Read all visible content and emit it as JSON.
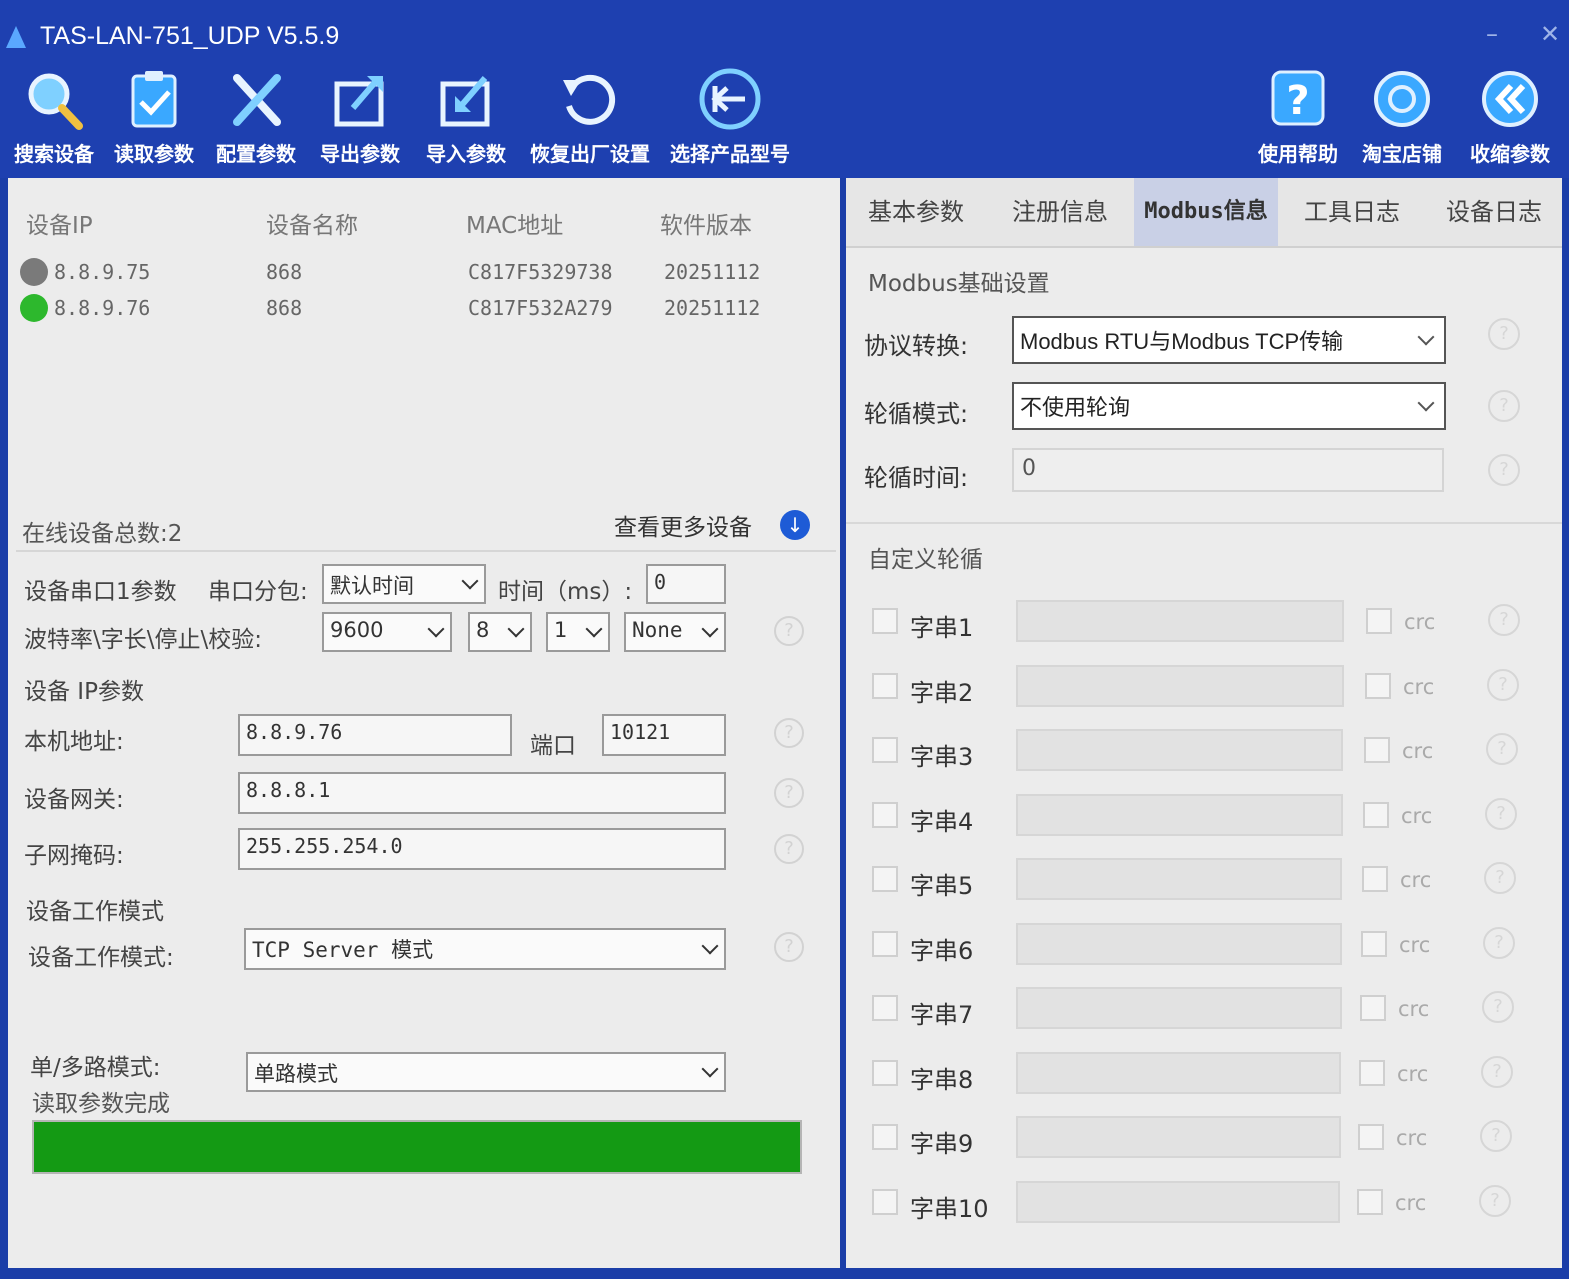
{
  "window": {
    "title": "TAS-LAN-751_UDP V5.5.9"
  },
  "toolbar": [
    {
      "label": "搜索设备",
      "icon": "magnifier-icon"
    },
    {
      "label": "读取参数",
      "icon": "clipboard-check-icon"
    },
    {
      "label": "配置参数",
      "icon": "tools-icon"
    },
    {
      "label": "导出参数",
      "icon": "export-icon"
    },
    {
      "label": "导入参数",
      "icon": "import-icon"
    },
    {
      "label": "恢复出厂设置",
      "icon": "reset-icon"
    },
    {
      "label": "选择产品型号",
      "icon": "select-model-icon"
    },
    {
      "label": "使用帮助",
      "icon": "help-icon"
    },
    {
      "label": "淘宝店铺",
      "icon": "taobao-icon"
    },
    {
      "label": "收缩参数",
      "icon": "collapse-icon"
    }
  ],
  "device_list": {
    "columns": [
      "设备IP",
      "设备名称",
      "MAC地址",
      "软件版本"
    ],
    "rows": [
      {
        "ip": "8.8.9.75",
        "name": "868",
        "mac": "C817F5329738",
        "version": "20251112",
        "status_color": "#777777"
      },
      {
        "ip": "8.8.9.76",
        "name": "868",
        "mac": "C817F532A279",
        "version": "20251112",
        "status_color": "#2db82d"
      }
    ],
    "online_count": "在线设备总数:2",
    "more_devices": "查看更多设备"
  },
  "serial": {
    "label": "设备串口1参数",
    "packet_label": "串口分包:",
    "packet_mode": "默认时间",
    "time_label": "时间（ms）:",
    "time_value": "0",
    "baud_label": "波特率\\字长\\停止\\校验:",
    "baud": "9600",
    "data_bits": "8",
    "stop_bits": "1",
    "parity": "None"
  },
  "ip_params": {
    "section": "设备 IP参数",
    "local_label": "本机地址:",
    "local_ip": "8.8.9.76",
    "port_label": "端口",
    "port": "10121",
    "gateway_label": "设备网关:",
    "gateway": "8.8.8.1",
    "mask_label": "子网掩码:",
    "mask": "255.255.254.0"
  },
  "work_mode": {
    "section": "设备工作模式",
    "label": "设备工作模式:",
    "value": "TCP Server 模式",
    "route_label": "单/多路模式:",
    "route_value": "单路模式"
  },
  "status": {
    "text": "读取参数完成",
    "progress_percent": 100,
    "progress_color": "#149a14"
  },
  "tabs": [
    {
      "label": "基本参数",
      "active": false
    },
    {
      "label": "注册信息",
      "active": false
    },
    {
      "label": "Modbus信息",
      "active": true
    },
    {
      "label": "工具日志",
      "active": false
    },
    {
      "label": "设备日志",
      "active": false
    }
  ],
  "modbus": {
    "section": "Modbus基础设置",
    "protocol_label": "协议转换:",
    "protocol_value": "Modbus RTU与Modbus TCP传输",
    "poll_mode_label": "轮循模式:",
    "poll_mode_value": "不使用轮询",
    "poll_time_label": "轮循时间:",
    "poll_time_value": "0"
  },
  "custom_poll": {
    "section": "自定义轮循",
    "crc_label": "crc",
    "strings": [
      "字串1",
      "字串2",
      "字串3",
      "字串4",
      "字串5",
      "字串6",
      "字串7",
      "字串8",
      "字串9",
      "字串10"
    ]
  },
  "help_glyph": "?",
  "colors": {
    "titlebar": "#1e40b0",
    "accent": "#1e5bd6"
  }
}
